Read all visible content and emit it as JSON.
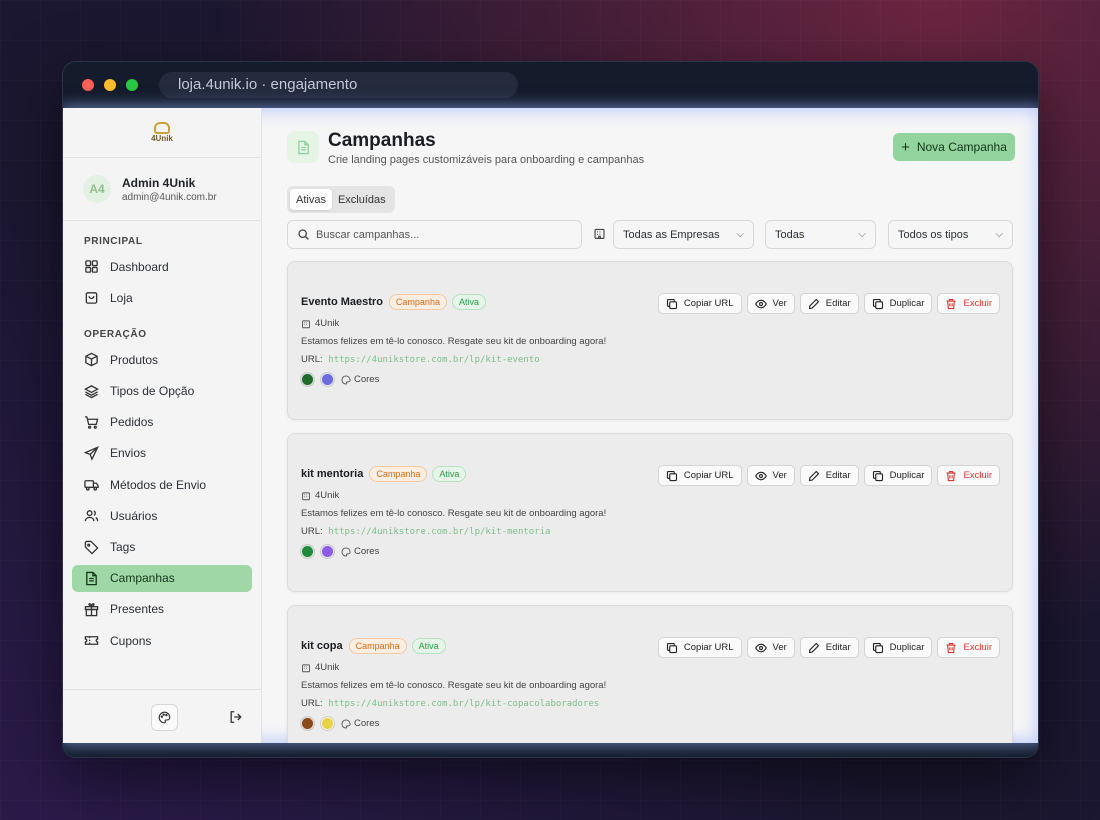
{
  "window": {
    "url": "loja.4unik.io · engajamento"
  },
  "brand": {
    "logo_text": "4Unik"
  },
  "user": {
    "initials": "A4",
    "name": "Admin 4Unik",
    "email": "admin@4unik.com.br"
  },
  "sidebar": {
    "sections": [
      {
        "label": "PRINCIPAL",
        "items": [
          {
            "label": "Dashboard",
            "icon": "dashboard-icon"
          },
          {
            "label": "Loja",
            "icon": "bag-icon"
          }
        ]
      },
      {
        "label": "OPERAÇÃO",
        "items": [
          {
            "label": "Produtos",
            "icon": "box-icon"
          },
          {
            "label": "Tipos de Opção",
            "icon": "layers-icon"
          },
          {
            "label": "Pedidos",
            "icon": "cart-icon"
          },
          {
            "label": "Envios",
            "icon": "send-icon"
          },
          {
            "label": "Métodos de Envio",
            "icon": "truck-icon"
          },
          {
            "label": "Usuários",
            "icon": "users-icon"
          },
          {
            "label": "Tags",
            "icon": "tag-icon"
          },
          {
            "label": "Campanhas",
            "icon": "document-icon",
            "active": true
          },
          {
            "label": "Presentes",
            "icon": "gift-icon"
          },
          {
            "label": "Cupons",
            "icon": "ticket-icon"
          }
        ]
      }
    ]
  },
  "page": {
    "title": "Campanhas",
    "subtitle": "Crie landing pages customizáveis para onboarding e campanhas",
    "new_button": "Nova Campanha"
  },
  "tabs": [
    {
      "label": "Ativas",
      "active": true
    },
    {
      "label": "Excluídas",
      "active": false
    }
  ],
  "filters": {
    "search_placeholder": "Buscar campanhas...",
    "company": "Todas as Empresas",
    "status": "Todas",
    "type": "Todos os tipos"
  },
  "actions": {
    "copy": "Copiar URL",
    "view": "Ver",
    "edit": "Editar",
    "duplicate": "Duplicar",
    "delete": "Excluir"
  },
  "url_label": "URL:",
  "colors_label": "Cores",
  "campaigns": [
    {
      "name": "Evento Maestro",
      "type_badge": "Campanha",
      "status_badge": "Ativa",
      "company": "4Unik",
      "description": "Estamos felizes em tê-lo conosco. Resgate seu kit de onboarding agora!",
      "url": "https://4unikstore.com.br/lp/kit-evento",
      "colors": [
        "#1f6b2c",
        "#6b6be0"
      ]
    },
    {
      "name": "kit mentoria",
      "type_badge": "Campanha",
      "status_badge": "Ativa",
      "company": "4Unik",
      "description": "Estamos felizes em tê-lo conosco. Resgate seu kit de onboarding agora!",
      "url": "https://4unikstore.com.br/lp/kit-mentoria",
      "colors": [
        "#1f8a3c",
        "#8b5ce6"
      ]
    },
    {
      "name": "kit copa",
      "type_badge": "Campanha",
      "status_badge": "Ativa",
      "company": "4Unik",
      "description": "Estamos felizes em tê-lo conosco. Resgate seu kit de onboarding agora!",
      "url": "https://4unikstore.com.br/lp/kit-copacolaboradores",
      "colors": [
        "#8a4a1a",
        "#e8d24a"
      ]
    }
  ]
}
